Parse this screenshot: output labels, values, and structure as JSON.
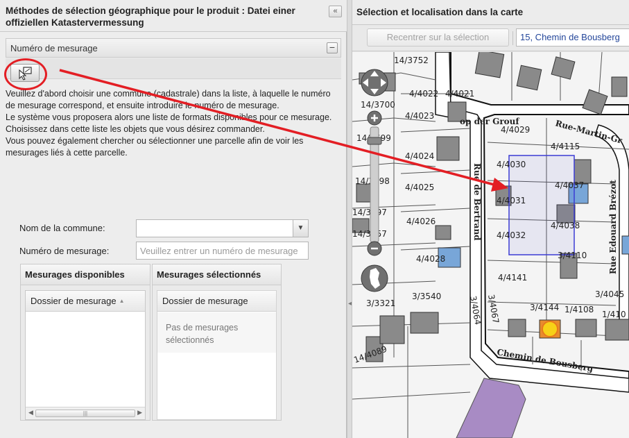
{
  "left_panel": {
    "title": "Méthodes de sélection géographique pour le produit : Datei einer offiziellen Katastervermessung",
    "collapse_icon": "double-chevron-left-icon",
    "section": {
      "label": "Numéro de mesurage",
      "collapse_icon": "minus-icon"
    },
    "tool_icon": "select-by-id-cursor-icon",
    "help_text": [
      "Veuillez d'abord choisir une commune (cadastrale) dans la liste, à laquelle le numéro de mesurage correspond, et ensuite introduire le numéro de mesurage.",
      "Le système vous proposera alors une liste de formats disponibles pour ce mesurage. Choisissez dans cette liste les objets que vous désirez commander.",
      "Vous pouvez également chercher ou sélectionner une parcelle afin de voir les mesurages liés à cette parcelle."
    ],
    "form": {
      "commune_label": "Nom de la commune:",
      "commune_value": "",
      "mesurage_label": "Numéro de mesurage:",
      "mesurage_placeholder": "Veuillez entrer un numéro de mesurage"
    },
    "available": {
      "title": "Mesurages disponibles",
      "column": "Dossier de mesurage"
    },
    "selected": {
      "title": "Mesurages sélectionnés",
      "column": "Dossier de mesurage",
      "empty_message": "Pas de mesurages sélectionnés"
    }
  },
  "right_panel": {
    "title": "Sélection et localisation dans la carte",
    "recenter_button": "Recentrer sur la sélection",
    "address": "15, Chemin de Bousberg",
    "map": {
      "streets": [
        "op der Grouf",
        "Rue-Martin-Gr",
        "Rue Edouard Brézot",
        "Rue de Bertrand",
        "Chemin de Bousberg",
        "3/4067",
        "3/4064"
      ],
      "parcels": [
        "14/3752",
        "4/4022",
        "4/4021",
        "14/3700",
        "4/4023",
        "14/3699",
        "4/4029",
        "4/4115",
        "4/4024",
        "4/4030",
        "4/4037",
        "14/3698",
        "4/4025",
        "4/4031",
        "14/3697",
        "4/4026",
        "4/4032",
        "4/4038",
        "14/3757",
        "4/4028",
        "3/4110",
        "4/4141",
        "3/4045",
        "3/3321",
        "3/3540",
        "3/4144",
        "1/4108",
        "1/410",
        "14/4089"
      ],
      "controls": [
        "pan-control-icon",
        "zoom-in-icon",
        "zoom-out-icon",
        "zoom-slider",
        "country-map-icon"
      ]
    }
  },
  "colors": {
    "accent_red": "#e31e24",
    "selection_blue": "#3b3bd4",
    "building_gray": "#8a8a8a",
    "highlight_yellow": "#f7d117",
    "plot_purple": "#a88bc4"
  }
}
